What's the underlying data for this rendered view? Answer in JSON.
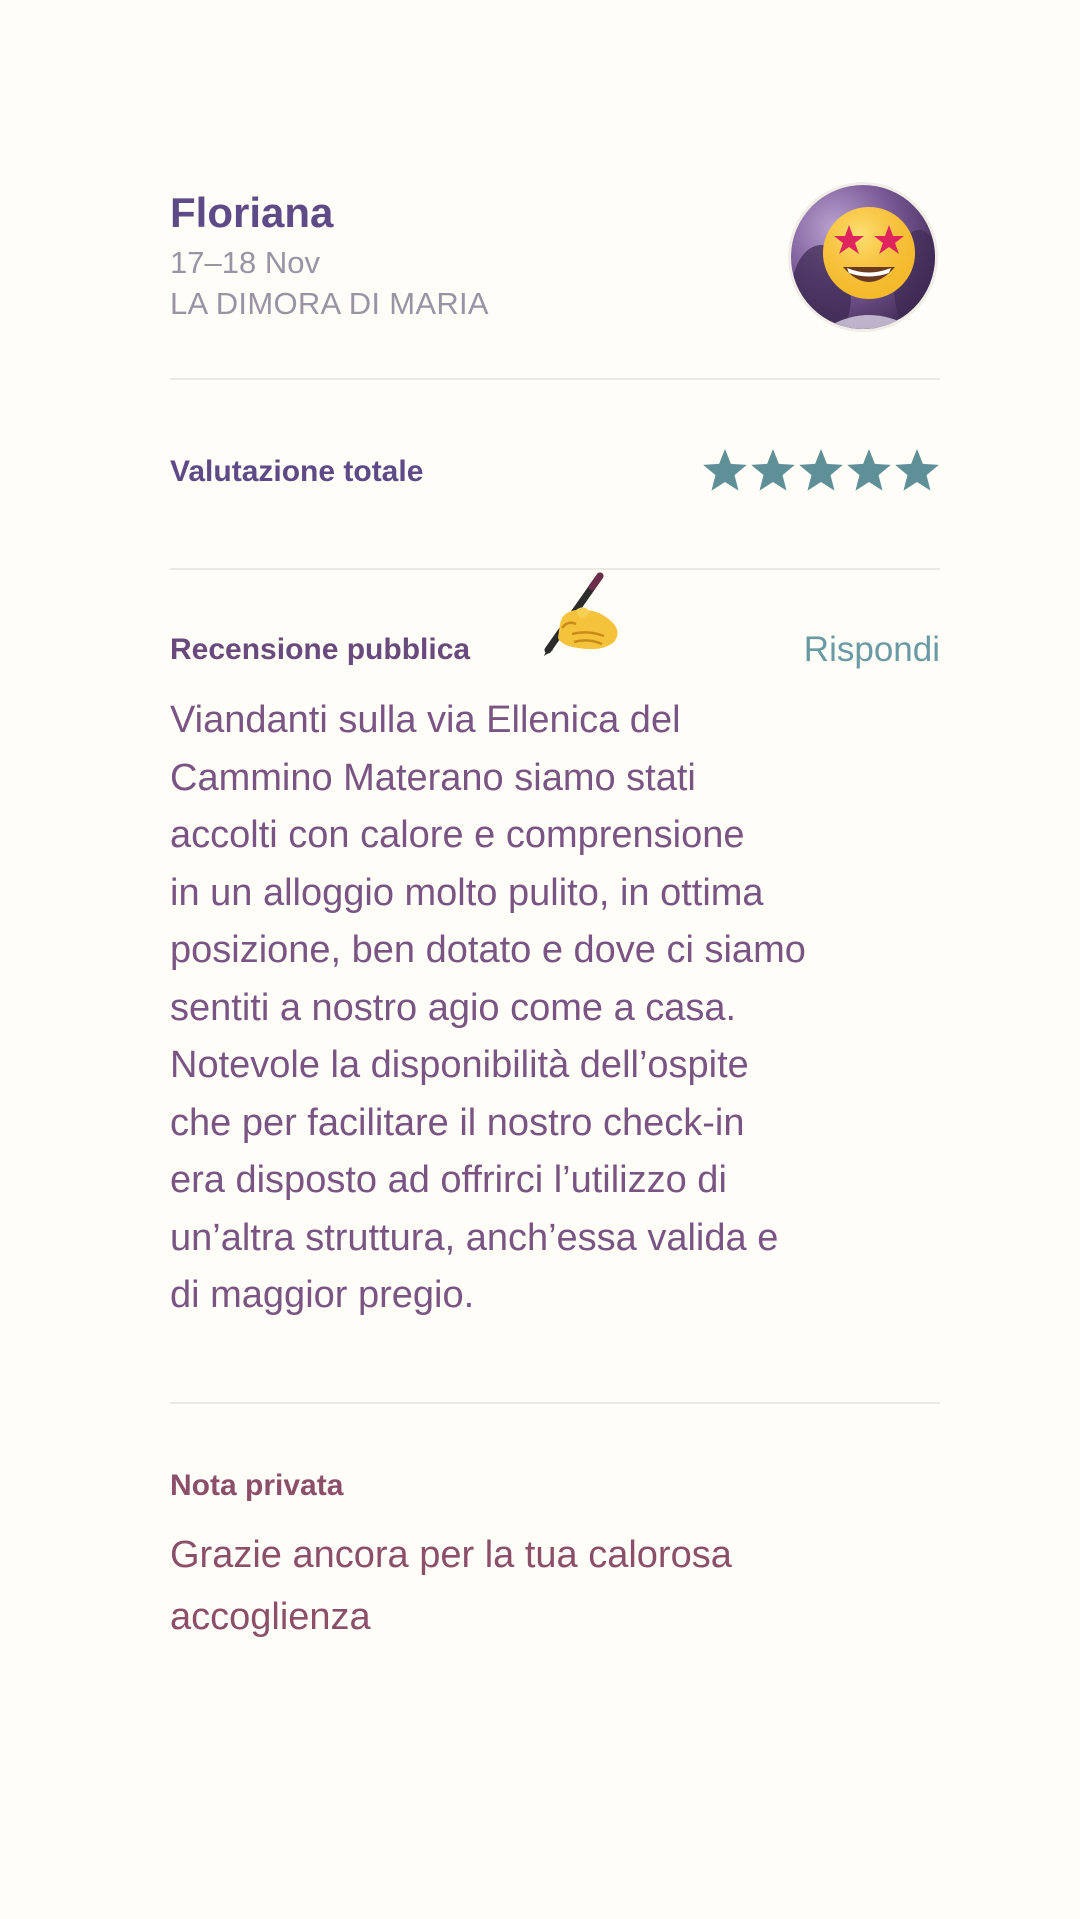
{
  "guest": {
    "name": "Floriana",
    "dates": "17–18 Nov",
    "listing": "LA DIMORA DI  MARIA",
    "avatar_icon": "star-struck-emoji"
  },
  "rating": {
    "label": "Valutazione totale",
    "stars": 5,
    "max_stars": 5,
    "star_color": "#5f8f97"
  },
  "public_review": {
    "label": "Recensione pubblica",
    "label_icon": "writing-hand-emoji",
    "reply_label": "Rispondi",
    "text": "Viandanti sulla via Ellenica del\nCammino Materano siamo stati\naccolti con calore e comprensione\nin un alloggio molto pulito, in ottima\nposizione, ben dotato e dove ci siamo\nsentiti a nostro agio come a casa.\nNotevole la disponibilità dell’ospite\nche per facilitare il nostro check-in\nera disposto ad offrirci l’utilizzo di\nun’altra struttura, anch’essa valida e\ndi maggior pregio."
  },
  "private_note": {
    "label": "Nota privata",
    "text": "Grazie ancora per la tua calorosa\naccoglienza"
  }
}
